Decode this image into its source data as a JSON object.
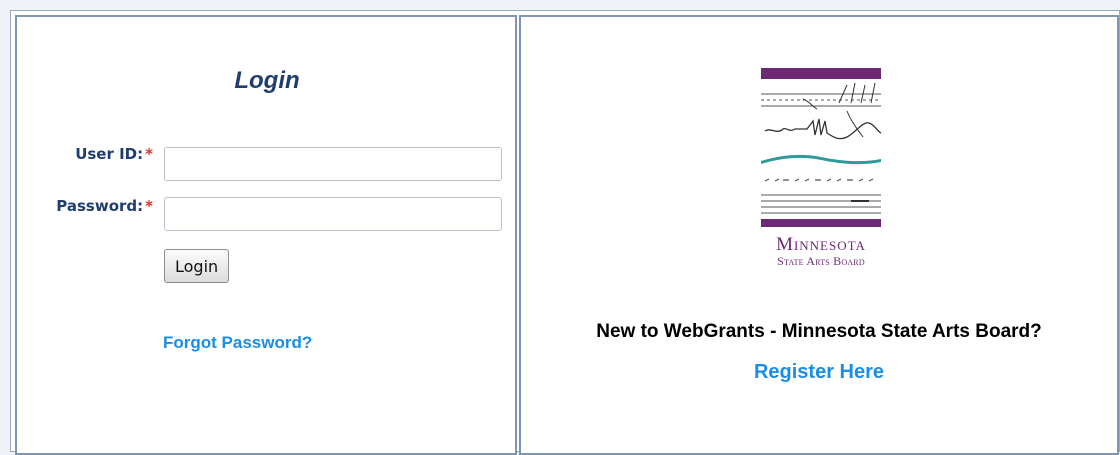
{
  "login": {
    "title": "Login",
    "user_id_label": "User ID:",
    "password_label": "Password:",
    "required_mark": "*",
    "user_id_value": "",
    "password_value": "",
    "login_button": "Login",
    "forgot_password": "Forgot Password?"
  },
  "logo": {
    "line1": "Minnesota",
    "line2": "State Arts Board"
  },
  "register": {
    "prompt": "New to WebGrants - Minnesota State Arts Board?",
    "link": "Register Here"
  },
  "colors": {
    "heading": "#1f3d6e",
    "link": "#1a8ee6",
    "required": "#e0332b",
    "logo_purple": "#6b2a73",
    "logo_teal": "#2e9a9a",
    "panel_border": "#7f95b2"
  }
}
